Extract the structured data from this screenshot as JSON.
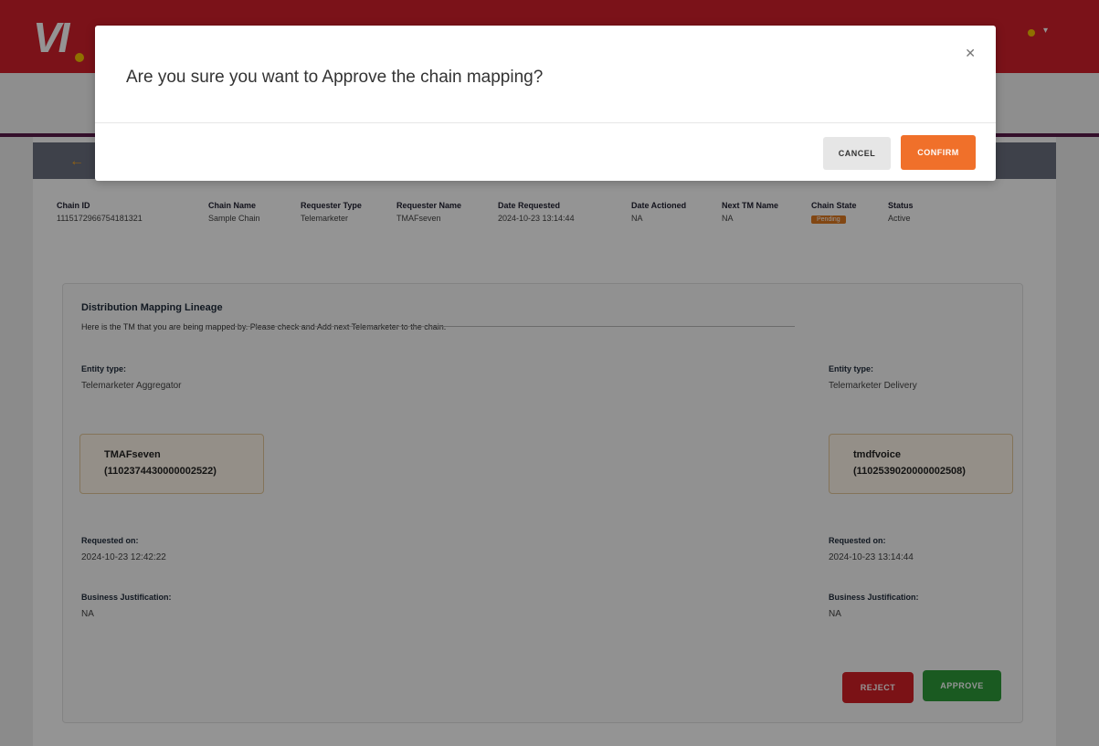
{
  "header": {
    "logo_text": "VI",
    "accent": "#d4202b",
    "logo_dot_color": "#f6c200"
  },
  "chain_info": {
    "columns": [
      {
        "label": "Chain ID",
        "value": "1115172966754181321"
      },
      {
        "label": "Chain Name",
        "value": "Sample Chain"
      },
      {
        "label": "Requester Type",
        "value": "Telemarketer"
      },
      {
        "label": "Requester Name",
        "value": "TMAFseven"
      },
      {
        "label": "Date Requested",
        "value": "2024-10-23 13:14:44"
      },
      {
        "label": "Date Actioned",
        "value": "NA"
      },
      {
        "label": "Next TM Name",
        "value": "NA"
      },
      {
        "label": "Chain State",
        "value": "Pending"
      },
      {
        "label": "Status",
        "value": "Active"
      }
    ]
  },
  "lineage": {
    "title": "Distribution Mapping Lineage",
    "subtitle": "Here is the TM that you are being mapped by. Please check and Add next Telemarketer to the chain.",
    "left": {
      "entity_label": "Entity type:",
      "entity_value": "Telemarketer Aggregator",
      "name": "TMAFseven",
      "id": "(1102374430000002522)",
      "requested_label": "Requested on:",
      "requested_value": "2024-10-23 12:42:22",
      "justification_label": "Business Justification:",
      "justification_value": "NA"
    },
    "right": {
      "entity_label": "Entity type:",
      "entity_value": "Telemarketer Delivery",
      "name": "tmdfvoice",
      "id": "(1102539020000002508)",
      "requested_label": "Requested on:",
      "requested_value": "2024-10-23 13:14:44",
      "justification_label": "Business Justification:",
      "justification_value": "NA"
    },
    "reject_label": "REJECT",
    "approve_label": "APPROVE"
  },
  "modal": {
    "message": "Are you sure you want to Approve the chain mapping?",
    "close_icon": "close-icon",
    "cancel_label": "CANCEL",
    "confirm_label": "CONFIRM",
    "confirm_color": "#f0702a"
  }
}
